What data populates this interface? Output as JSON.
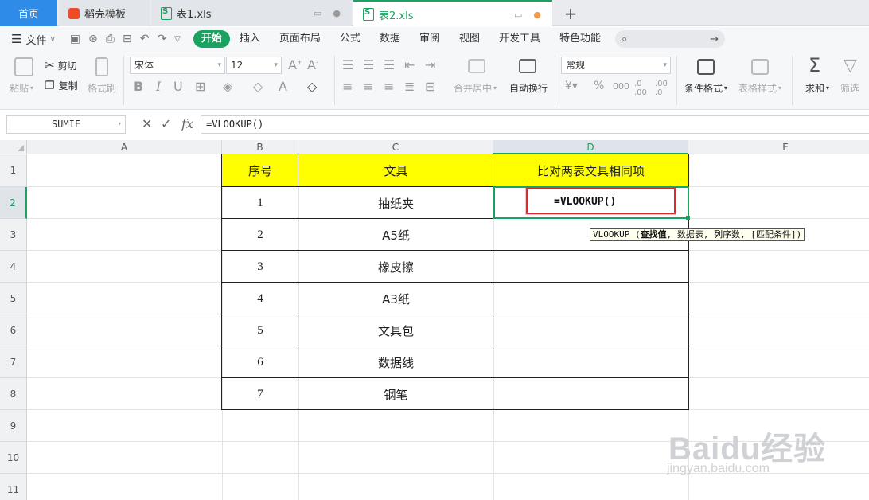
{
  "tabs": {
    "home": "首页",
    "daoke": "稻壳模板",
    "file1": "表1.xls",
    "file2": "表2.xls",
    "add": "+"
  },
  "menu": {
    "file": "文件",
    "items": [
      "开始",
      "插入",
      "页面布局",
      "公式",
      "数据",
      "审阅",
      "视图",
      "开发工具",
      "特色功能"
    ],
    "search_placeholder": ""
  },
  "ribbon": {
    "paste": "粘贴",
    "cut": "剪切",
    "copy": "复制",
    "format_painter": "格式刷",
    "font_name": "宋体",
    "font_size": "12",
    "merge_center": "合并居中",
    "wrap_text": "自动换行",
    "number_format": "常规",
    "conditional_format": "条件格式",
    "table_style": "表格样式",
    "sum": "求和",
    "filter": "筛选",
    "bold": "B",
    "italic": "I",
    "underline": "U"
  },
  "formula_bar": {
    "name_box": "SUMIF",
    "cancel": "✕",
    "confirm": "✓",
    "fx": "fx",
    "formula": "=VLOOKUP()"
  },
  "sheet": {
    "columns": [
      "A",
      "B",
      "C",
      "D",
      "E"
    ],
    "rows": [
      "1",
      "2",
      "3",
      "4",
      "5",
      "6",
      "7",
      "8",
      "9",
      "10",
      "11"
    ],
    "selected_column": "D",
    "selected_row": "2",
    "headers": {
      "b": "序号",
      "c": "文具",
      "d": "比对两表文具相同项"
    },
    "data": [
      {
        "no": "1",
        "item": "抽纸夹"
      },
      {
        "no": "2",
        "item": "A5纸"
      },
      {
        "no": "3",
        "item": "橡皮擦"
      },
      {
        "no": "4",
        "item": "A3纸"
      },
      {
        "no": "5",
        "item": "文具包"
      },
      {
        "no": "6",
        "item": "数据线"
      },
      {
        "no": "7",
        "item": "钢笔"
      }
    ],
    "editing_text": "=VLOOKUP()",
    "tooltip": {
      "fn": "VLOOKUP",
      "open": " (",
      "arg1": "查找值",
      "rest": ", 数据表, 列序数, [匹配条件])"
    }
  },
  "watermark": {
    "brand": "Baidu经验",
    "url": "jingyan.baidu.com"
  },
  "colors": {
    "accent_green": "#1aa260",
    "header_fill": "#ffff00",
    "highlight_red": "#e0282b",
    "home_tab": "#2e8be8"
  }
}
